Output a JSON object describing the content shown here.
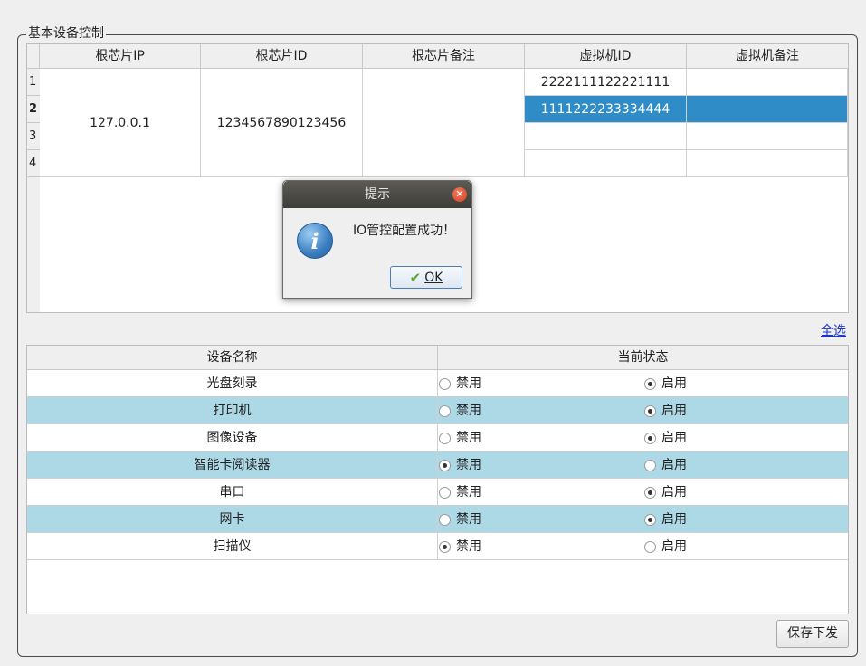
{
  "group_title": "基本设备控制",
  "chip_table": {
    "headers": [
      "根芯片IP",
      "根芯片ID",
      "根芯片备注",
      "虚拟机ID",
      "虚拟机备注"
    ],
    "row_numbers": [
      "1",
      "2",
      "3",
      "4"
    ],
    "merged": {
      "ip": "127.0.0.1",
      "id": "1234567890123456",
      "note": ""
    },
    "vm_rows": [
      {
        "vm_id": "2222111122221111",
        "vm_note": ""
      },
      {
        "vm_id": "1111222233334444",
        "vm_note": "",
        "selected": true
      },
      {
        "vm_id": "",
        "vm_note": ""
      },
      {
        "vm_id": "",
        "vm_note": ""
      }
    ]
  },
  "select_all": "全选",
  "device_table": {
    "headers": [
      "设备名称",
      "当前状态"
    ],
    "disable_label": "禁用",
    "enable_label": "启用",
    "rows": [
      {
        "name": "光盘刻录",
        "state": "enabled"
      },
      {
        "name": "打印机",
        "state": "enabled"
      },
      {
        "name": "图像设备",
        "state": "enabled"
      },
      {
        "name": "智能卡阅读器",
        "state": "disabled"
      },
      {
        "name": "串口",
        "state": "enabled"
      },
      {
        "name": "网卡",
        "state": "enabled"
      },
      {
        "name": "扫描仪",
        "state": "disabled"
      }
    ]
  },
  "save_button": "保存下发",
  "dialog": {
    "title": "提示",
    "message": "IO管控配置成功！",
    "ok_label": "OK",
    "icon": "info-icon"
  },
  "colors": {
    "selected_row": "#308cc6",
    "alt_row": "#add8e6",
    "link": "#1a33d8"
  }
}
